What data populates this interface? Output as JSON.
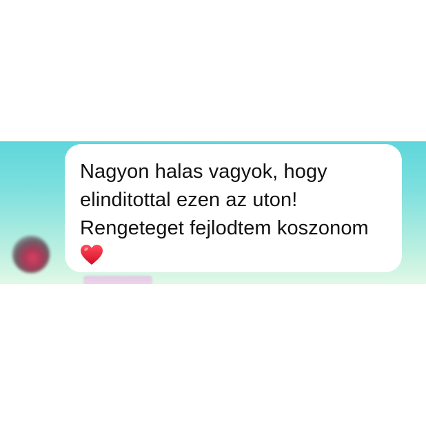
{
  "chat": {
    "message": {
      "text": "Nagyon halas vagyok, hogy\nelinditottal ezen az uton!\nRengeteget fejlodtem koszonom",
      "emoji": "heart-icon"
    },
    "avatar": "blurred-avatar"
  },
  "colors": {
    "background_top": "#5fd6dc",
    "background_bottom": "#e2f8e6",
    "bubble": "#ffffff",
    "text": "#111111",
    "heart": "#e8112d"
  }
}
